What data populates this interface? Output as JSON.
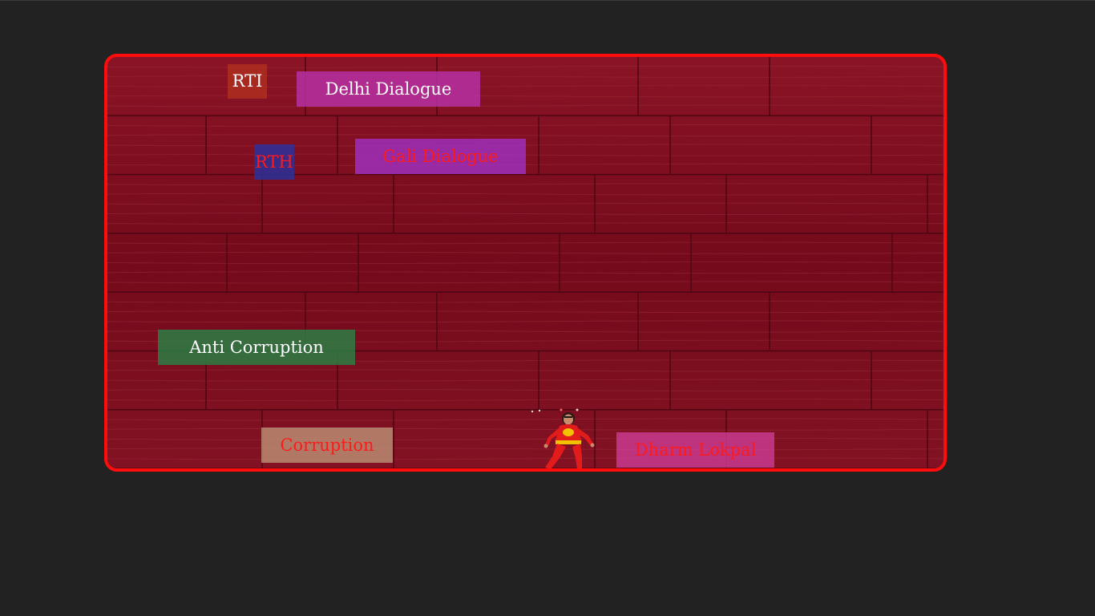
{
  "game": {
    "frame_color": "#ff0d0d",
    "background_color": "#222222",
    "floor_color": "#7a0a1c",
    "blocks": [
      {
        "name": "rti-block",
        "label": "RTI",
        "bg": "rgba(180,50,30,0.72)",
        "color": "#ffffff"
      },
      {
        "name": "delhi-dialogue-block",
        "label": "Delhi Dialogue",
        "bg": "rgba(185,50,170,0.80)",
        "color": "#ffffff"
      },
      {
        "name": "rth-block",
        "label": "RTH",
        "bg": "rgba(40,50,160,0.82)",
        "color": "#ff1a1a"
      },
      {
        "name": "gali-dialogue-block",
        "label": "Gali Dialogue",
        "bg": "rgba(160,50,200,0.78)",
        "color": "#ff1a1a"
      },
      {
        "name": "anti-corruption-block",
        "label": "Anti Corruption",
        "bg": "rgba(40,130,70,0.82)",
        "color": "#ffffff"
      },
      {
        "name": "corruption-block",
        "label": "Corruption",
        "bg": "rgba(190,150,120,0.78)",
        "color": "#ff1a1a"
      },
      {
        "name": "dharm-lokpal-block",
        "label": "Dharm Lokpal",
        "bg": "rgba(205,60,150,0.80)",
        "color": "#ff1a1a"
      }
    ],
    "player": {
      "name": "player-character",
      "suit_color": "#e21b1b",
      "emblem_color": "#f2c200"
    }
  }
}
